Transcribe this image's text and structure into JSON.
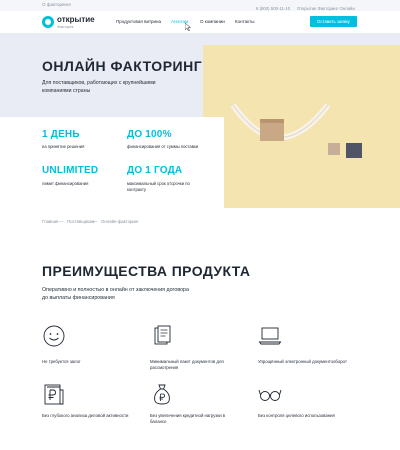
{
  "topbar": {
    "about_link": "О факторинге"
  },
  "header": {
    "logo_text": "открытие",
    "logo_sub": "Факторинг",
    "nav": [
      {
        "label": "Продуктовая витрина",
        "active": false
      },
      {
        "label": "Агентам",
        "active": true
      },
      {
        "label": "О компании",
        "active": false
      },
      {
        "label": "Контакты",
        "active": false
      }
    ],
    "phone": "8 (800) 500-11-10",
    "online_link": "Открытие Факторинг Онлайн",
    "apply_button": "Оставить заявку"
  },
  "hero": {
    "title": "ОНЛАЙН ФАКТОРИНГ",
    "subtitle": "Для поставщиков, работающих с крупнейшими компаниями страны",
    "facts": [
      {
        "value": "1 ДЕНЬ",
        "text": "на принятие решения"
      },
      {
        "value": "ДО 100%",
        "text": "финансирования от суммы поставки"
      },
      {
        "value": "UNLIMITED",
        "text": "лимит финансирования"
      },
      {
        "value": "ДО 1 ГОДА",
        "text": "максимальный срок отсрочки по контракту"
      }
    ]
  },
  "breadcrumb": {
    "items": [
      "Главная",
      "Поставщикам",
      "Онлайн-факторинг"
    ],
    "separator": "—"
  },
  "advantages": {
    "title": "ПРЕИМУЩЕСТВА ПРОДУКТА",
    "subtitle": "Оперативно и полностью в онлайн от заключения договора до выплаты финансирования",
    "items": [
      {
        "icon": "smile-icon",
        "text": "Не требуется залог"
      },
      {
        "icon": "documents-icon",
        "text": "Минимальный пакет документов для рассмотрения"
      },
      {
        "icon": "laptop-icon",
        "text": "Упрощённый электронный документооборот"
      },
      {
        "icon": "ruble-document-icon",
        "text": "Без глубокого анализа деловой активности"
      },
      {
        "icon": "money-bag-icon",
        "text": "Без увеличения кредитной нагрузки в балансе"
      },
      {
        "icon": "glasses-icon",
        "text": "Без контроля целевого использования"
      }
    ]
  },
  "colors": {
    "accent": "#00bfdf",
    "hero_bg": "#e9ebf5",
    "image_bg": "#f3e4b0"
  }
}
